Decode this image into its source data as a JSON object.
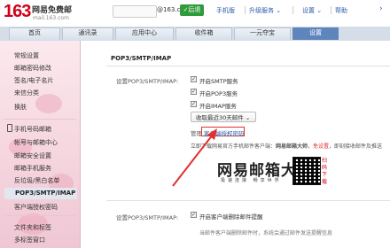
{
  "header": {
    "logo_number": "163",
    "logo_title": "网易免费邮",
    "logo_domain": "mail.163.com",
    "email_domain": "@163.com",
    "quick_button": "✓后退",
    "links": [
      "手机版",
      "升级服务 ⌄",
      "设置 ⌄",
      "帮助"
    ],
    "arrow": "›"
  },
  "tabs": [
    {
      "label": "首页"
    },
    {
      "label": "通讯录"
    },
    {
      "label": "应用中心"
    },
    {
      "label": "收件箱"
    },
    {
      "label": "一元夺宝"
    },
    {
      "label": "设置"
    }
  ],
  "sidebar": {
    "items": [
      {
        "label": "常规设置"
      },
      {
        "label": "邮箱密码修改"
      },
      {
        "label": "签名/电子名片"
      },
      {
        "label": "来信分类"
      },
      {
        "label": "换肤"
      },
      {
        "label": "手机号码邮箱"
      },
      {
        "label": "帐号与邮箱中心"
      },
      {
        "label": "邮箱安全设置"
      },
      {
        "label": "邮箱手机服务"
      },
      {
        "label": "反垃圾/黑白名单"
      },
      {
        "label": "POP3/SMTP/IMAP"
      },
      {
        "label": "客户端授权密码"
      },
      {
        "label": "文件夹和标签"
      },
      {
        "label": "多标签窗口"
      }
    ]
  },
  "section": {
    "title": "POP3/SMTP/IMAP",
    "row_label": "设置POP3/SMTP/IMAP:",
    "checkboxes": [
      {
        "label": "开启SMTP服务",
        "mark": "✓"
      },
      {
        "label": "开启POP3服务",
        "mark": "✓"
      },
      {
        "label": "开启IMAP服务",
        "mark": "✓"
      }
    ],
    "recv_select": "收取最近30天邮件 ⌄",
    "manage_label": "管理",
    "auth_link": "客户端授权密码",
    "note_prefix": "立即下载网易官方手机邮件客户端：",
    "note_bold": "网易邮箱大师",
    "note_free": "，免设置",
    "note_suffix": "，即刻接收邮件及推送",
    "row2_label": "设置POP3/SMTP/IMAP:",
    "delete_checkbox": {
      "label": "开启客户端删除邮件提醒",
      "mark": "✓"
    },
    "delete_note": "当邮件客户端删除邮件时，系统会通过邮件发送提醒信息"
  },
  "watermark": {
    "title": "网易邮箱大师",
    "subtitle": "极速连接 畅享世界",
    "scan_text": "扫码下载"
  },
  "colors": {
    "accent_red": "#d0021b",
    "active_tab": "#5e86bd",
    "link_blue": "#2b5aa8",
    "annotation_red": "#e03030"
  }
}
